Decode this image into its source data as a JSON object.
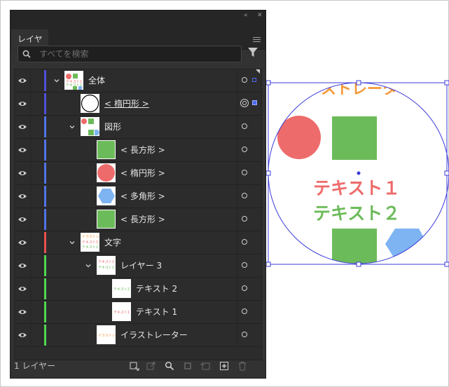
{
  "panel": {
    "tab_label": "レイヤー",
    "search_placeholder": "すべてを検索",
    "footer_text": "1 レイヤー",
    "title_buttons": [
      "«",
      "✕"
    ],
    "colors": {
      "bg": "#323232",
      "selection": "#4a6cf2"
    }
  },
  "layers": [
    {
      "name": "全体",
      "level": 0,
      "expanded": true,
      "color": "#4f4fdc",
      "thumb": "whole",
      "target": "single",
      "selection": "small"
    },
    {
      "name": "< 楕円形 >",
      "level": 1,
      "color": "#4f4fdc",
      "thumb": "circle-outline",
      "target": "double",
      "selection": "filled",
      "underline": true
    },
    {
      "name": "図形",
      "level": 1,
      "expanded": true,
      "color": "#4f74e8",
      "thumb": "shapes",
      "target": "single"
    },
    {
      "name": "< 長方形 >",
      "level": 2,
      "color": "#4f74e8",
      "thumb": "rect-green",
      "target": "single"
    },
    {
      "name": "< 楕円形 >",
      "level": 2,
      "color": "#4f74e8",
      "thumb": "circle-red",
      "target": "single"
    },
    {
      "name": "< 多角形 >",
      "level": 2,
      "color": "#4f74e8",
      "thumb": "hex-blue",
      "target": "single"
    },
    {
      "name": "< 長方形 >",
      "level": 2,
      "color": "#4f74e8",
      "thumb": "rect-green",
      "target": "single"
    },
    {
      "name": "文字",
      "level": 1,
      "expanded": true,
      "color": "#e84f4f",
      "thumb": "text-all",
      "target": "single"
    },
    {
      "name": "レイヤー 3",
      "level": 2,
      "expanded": true,
      "color": "#4fd84f",
      "thumb": "text-12",
      "target": "single"
    },
    {
      "name": "テキスト 2",
      "level": 3,
      "color": "#4fd84f",
      "thumb": "text-2",
      "target": "single"
    },
    {
      "name": "テキスト 1",
      "level": 3,
      "color": "#4fd84f",
      "thumb": "text-1",
      "target": "single"
    },
    {
      "name": "イラストレーター",
      "level": 2,
      "color": "#4fd84f",
      "thumb": "text-illust",
      "target": "single"
    }
  ],
  "artboard": {
    "header_text": "ストレーター",
    "text1": "テキスト１",
    "text2": "テキスト２",
    "colors": {
      "red": "#ee6b6b",
      "green": "#6cbb5a",
      "blue": "#7fb4f2",
      "orange": "#f59a3c",
      "selection": "#3b3bd8"
    }
  }
}
